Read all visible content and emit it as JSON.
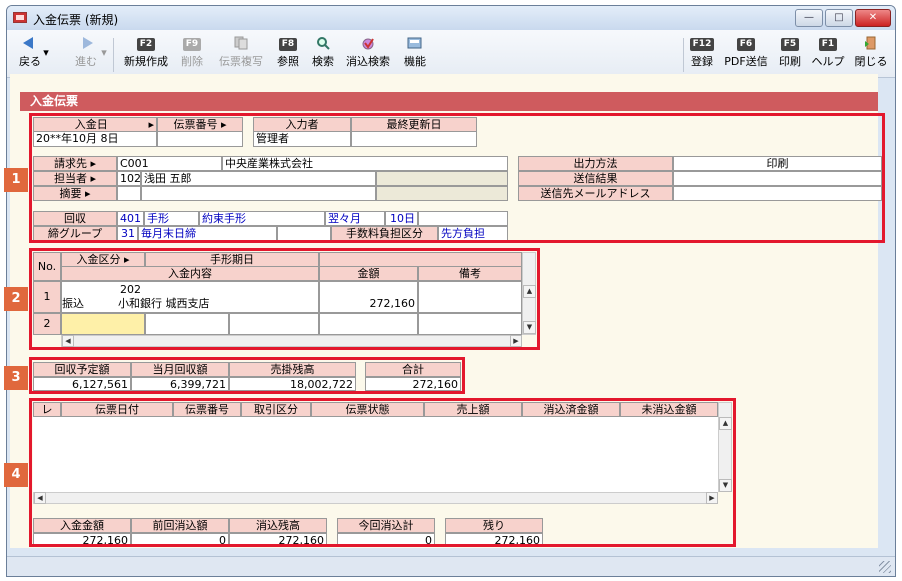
{
  "window": {
    "title": "入金伝票 (新規)",
    "btn_min": "—",
    "btn_max": "□",
    "btn_close": "✕"
  },
  "toolbar": {
    "back": "戻る",
    "forward": "進む",
    "new": {
      "key": "F2",
      "label": "新規作成"
    },
    "delete": {
      "key": "F9",
      "label": "削除"
    },
    "copy": {
      "key": "",
      "label": "伝票複写"
    },
    "ref": {
      "key": "F8",
      "label": "参照"
    },
    "search": {
      "label": "検索"
    },
    "clear_search": {
      "label": "消込検索"
    },
    "func": {
      "label": "機能"
    },
    "register": {
      "key": "F12",
      "label": "登録"
    },
    "pdf": {
      "key": "F6",
      "label": "PDF送信"
    },
    "print": {
      "key": "F5",
      "label": "印刷"
    },
    "help": {
      "key": "F1",
      "label": "ヘルプ"
    },
    "close": {
      "label": "閉じる"
    }
  },
  "section_title": "入金伝票",
  "s1": {
    "date_label": "入金日",
    "slip_label": "伝票番号",
    "inputter_label": "入力者",
    "updated_label": "最終更新日",
    "date_value": "20**年10月 8日",
    "inputter_value": "管理者",
    "billing_label": "請求先",
    "billing_code": "C001",
    "billing_name": "中央産業株式会社",
    "staff_label": "担当者",
    "staff_code": "102",
    "staff_name": "浅田 五郎",
    "memo_label": "摘要",
    "output_label": "出力方法",
    "output_value": "印刷",
    "result_label": "送信結果",
    "email_label": "送信先メールアドレス",
    "collect_label": "回収",
    "collect_code": "401",
    "collect_type": "手形",
    "collect_terms": "約束手形",
    "collect_month": "翌々月",
    "collect_day": "10日",
    "group_label": "締グループ",
    "group_code": "31",
    "group_name": "毎月末日締",
    "fee_label": "手数料負担区分",
    "fee_value": "先方負担"
  },
  "s2": {
    "no": "No.",
    "kind": "入金区分",
    "due": "手形期日",
    "content": "入金内容",
    "amount": "金額",
    "remarks": "備考",
    "row1": {
      "no": "1",
      "top": "202",
      "kind": "振込",
      "content": "小和銀行 城西支店",
      "amount": "272,160"
    },
    "row2": {
      "no": "2"
    }
  },
  "s3": {
    "plan_label": "回収予定額",
    "plan": "6,127,561",
    "month_label": "当月回収額",
    "month": "6,399,721",
    "ar_label": "売掛残高",
    "ar": "18,002,722",
    "total_label": "合計",
    "total": "272,160"
  },
  "s4": {
    "cols": [
      "レ",
      "伝票日付",
      "伝票番号",
      "取引区分",
      "伝票状態",
      "売上額",
      "消込済金額",
      "未消込金額"
    ],
    "pay_label": "入金金額",
    "pay": "272,160",
    "prev_label": "前回消込額",
    "prev": "0",
    "remain_label": "消込残高",
    "remain": "272,160",
    "now_label": "今回消込計",
    "now": "0",
    "rest_label": "残り",
    "rest": "272,160"
  },
  "markers": [
    "1",
    "2",
    "3",
    "4"
  ]
}
